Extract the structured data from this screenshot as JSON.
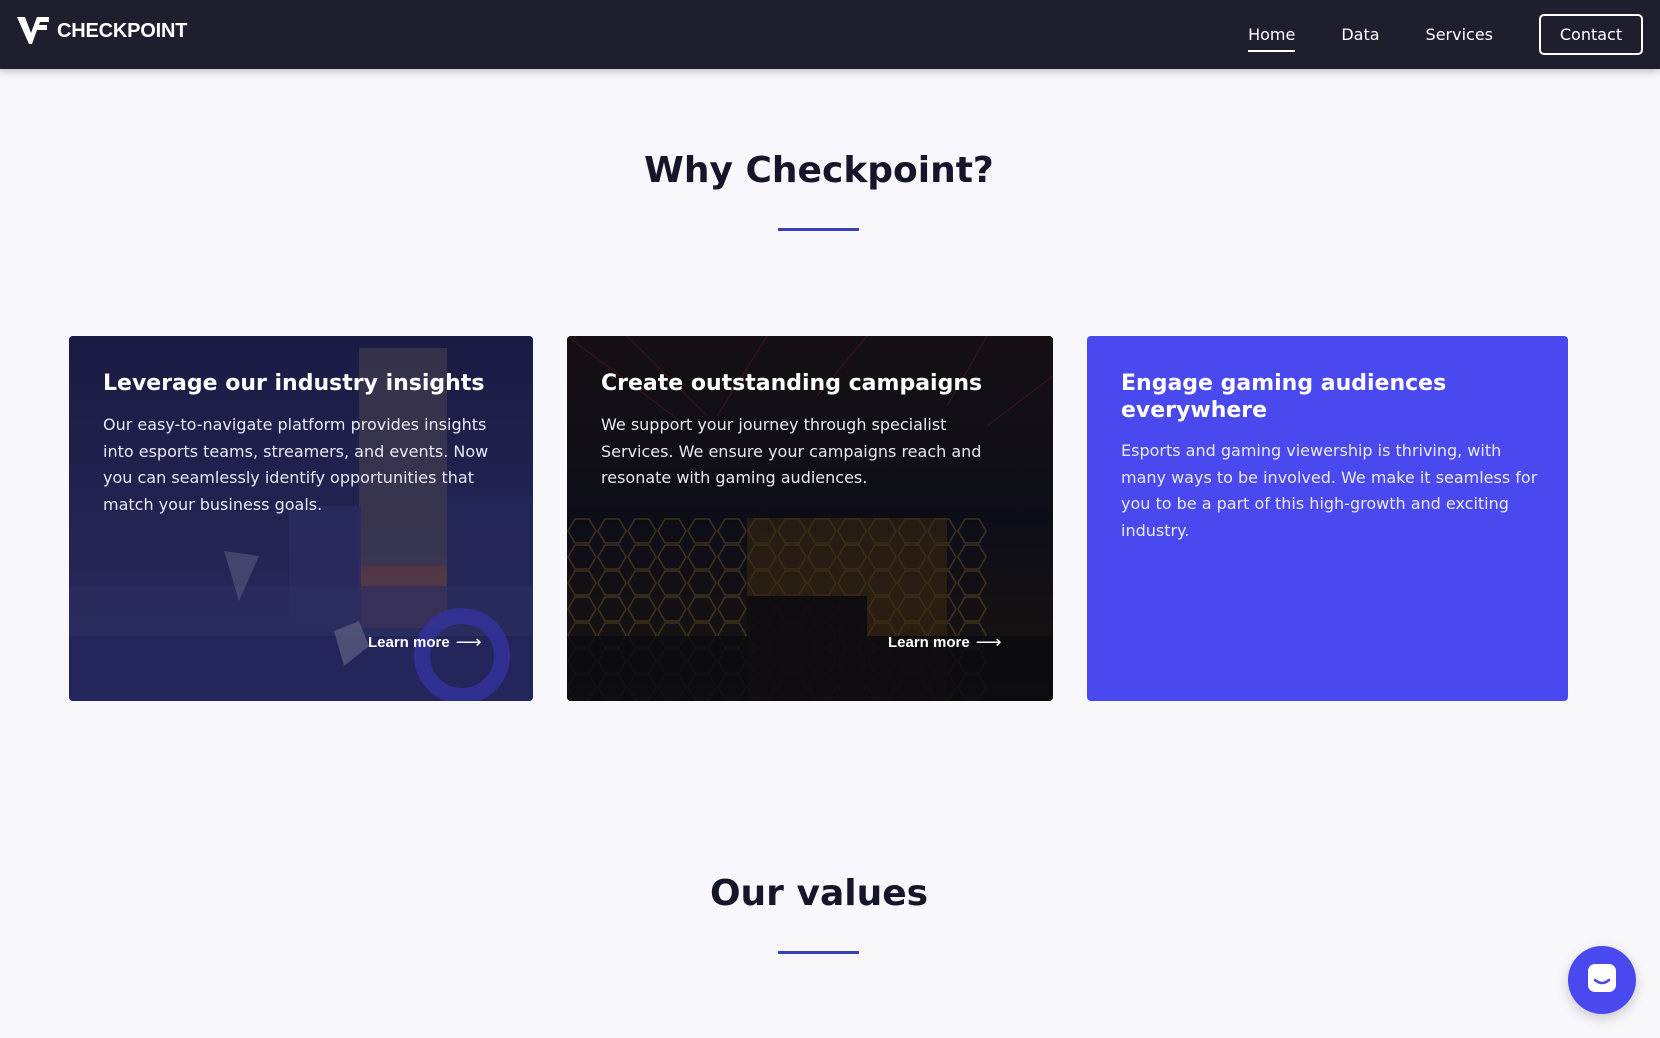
{
  "brand": {
    "name": "CHECKPOINT"
  },
  "nav": {
    "links": [
      {
        "label": "Home",
        "active": true
      },
      {
        "label": "Data",
        "active": false
      },
      {
        "label": "Services",
        "active": false
      }
    ],
    "contact_label": "Contact"
  },
  "why": {
    "title": "Why Checkpoint?",
    "cards": [
      {
        "title": "Leverage our industry insights",
        "text": "Our easy-to-navigate platform provides insights into esports teams, streamers, and events. Now you can seamlessly identify opportunities that match your business goals.",
        "link": "Learn more"
      },
      {
        "title": "Create outstanding campaigns",
        "text": "We support your journey through specialist Services. We ensure your campaigns reach and resonate with gaming audiences.",
        "link": "Learn more"
      },
      {
        "title": "Engage gaming audiences everywhere",
        "text": "Esports and gaming viewership is thriving, with many ways to be involved. We make it seamless for you to be a part of this high-growth and exciting industry."
      }
    ]
  },
  "values": {
    "title": "Our values"
  },
  "colors": {
    "nav_bg": "#1e1f2e",
    "accent": "#4a48ef",
    "divider": "#3d3fb8"
  },
  "icons": {
    "logo": "checkpoint-logo-icon",
    "arrow": "arrow-right-icon",
    "chat": "chat-icon"
  }
}
